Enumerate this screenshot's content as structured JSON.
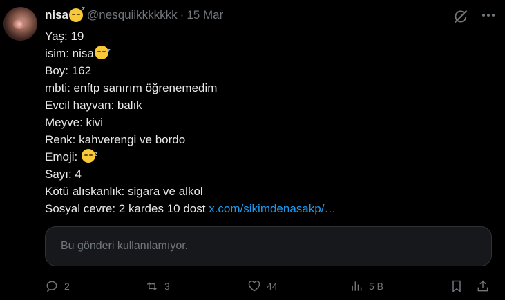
{
  "tweet": {
    "author_name": "nisa",
    "handle": "@nesquiikkkkkkk",
    "separator": "·",
    "date": "15 Mar",
    "lines": [
      {
        "text": "Yaş: 19"
      },
      {
        "text": "isim: nisa",
        "emoji": "sleeping-face"
      },
      {
        "text": "Boy: 162"
      },
      {
        "text": "mbti: enftp sanırım öğrenemedim"
      },
      {
        "text": "Evcil hayvan: balık"
      },
      {
        "text": "Meyve: kivi"
      },
      {
        "text": "Renk: kahverengi ve bordo"
      },
      {
        "text": "Emoji:",
        "emoji": "sleeping-face"
      },
      {
        "text": "Sayı: 4"
      },
      {
        "text": "Kötü alıskanlık: sigara ve alkol"
      },
      {
        "text": "Sosyal cevre: 2 kardes 10 dost",
        "link": "x.com/sikimdenasakp/…"
      }
    ],
    "quoted_unavailable": "Bu gönderi kullanılamıyor.",
    "stats": {
      "replies": "2",
      "reposts": "3",
      "likes": "44",
      "views": "5 B"
    }
  },
  "colors": {
    "background": "#000000",
    "text": "#e7e9ea",
    "muted": "#71767b",
    "link": "#1d9bf0",
    "emoji": "#f6c83a"
  }
}
